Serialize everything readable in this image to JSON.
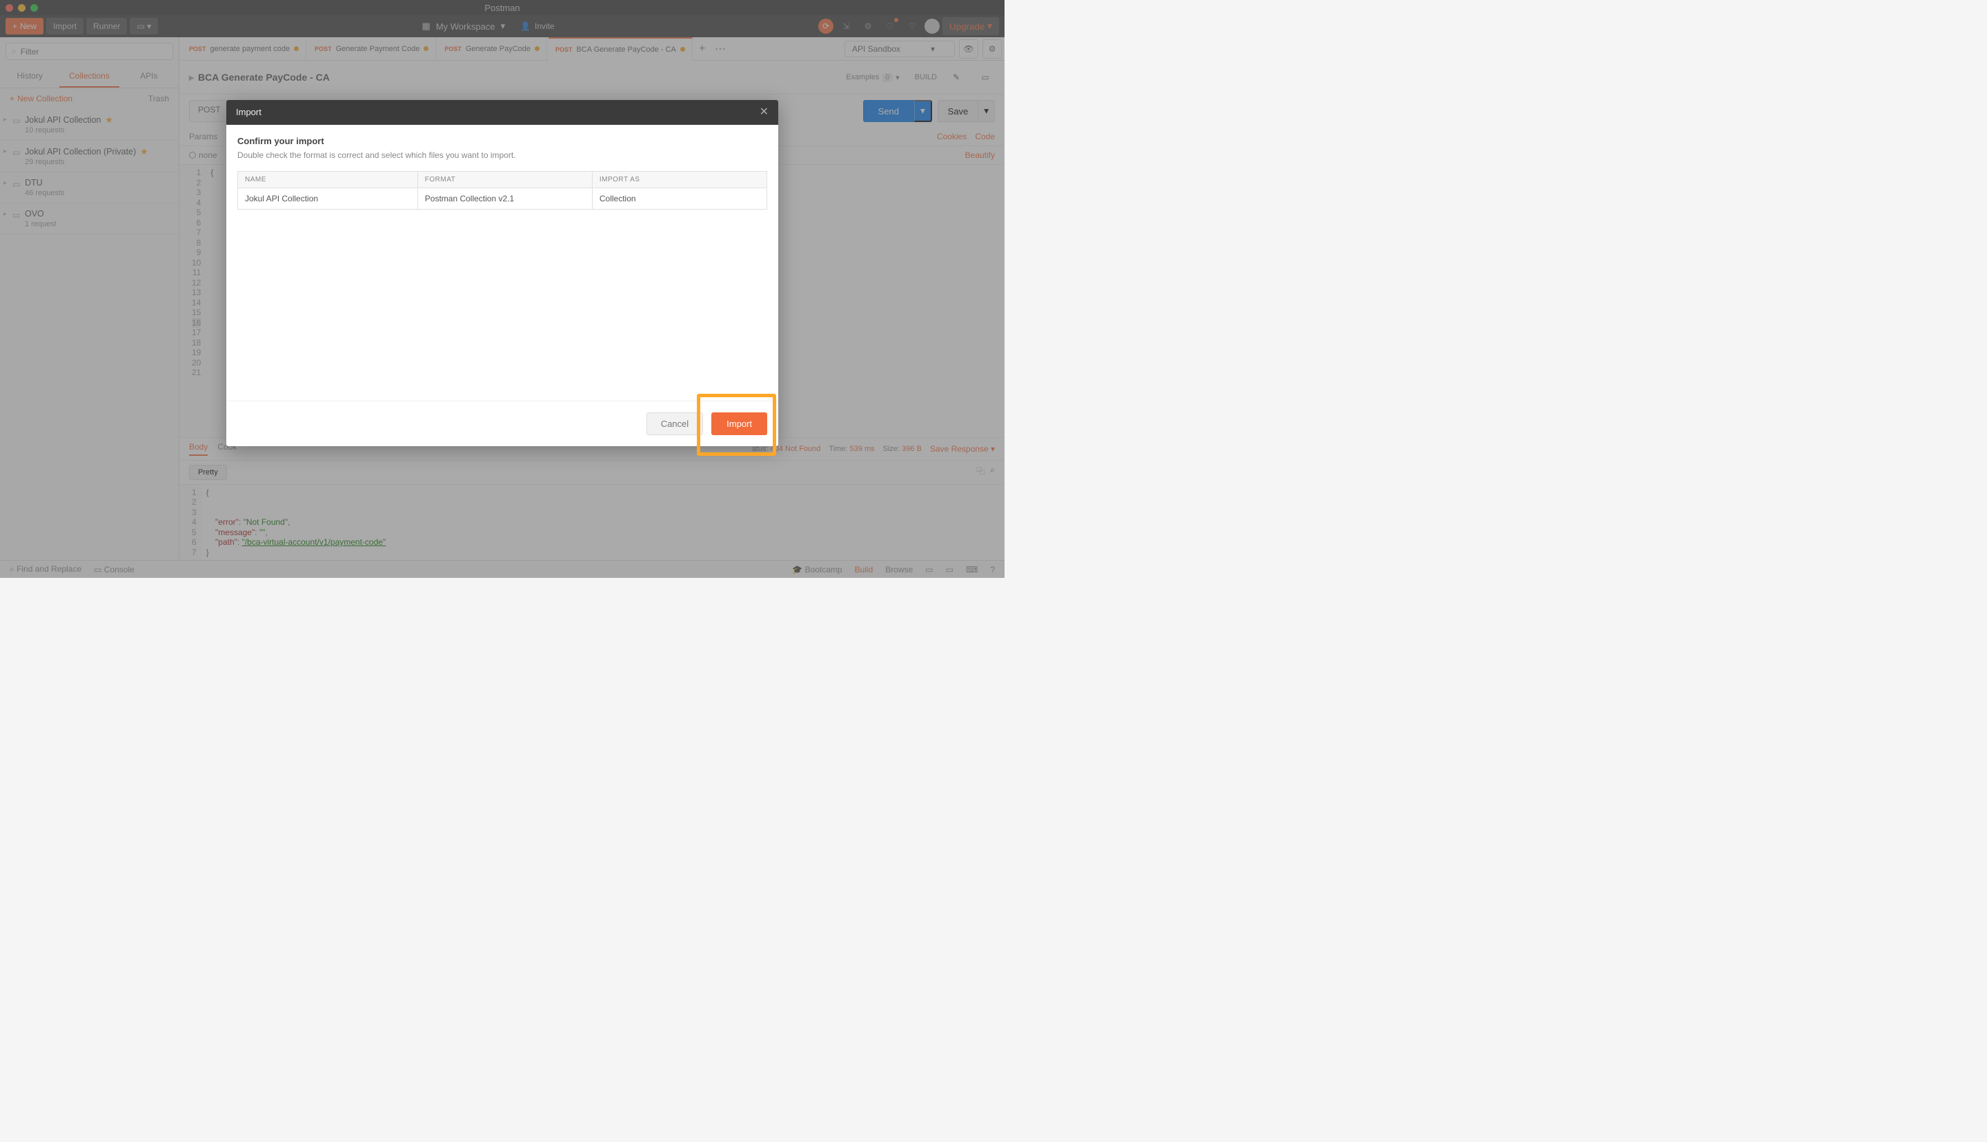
{
  "titlebar": {
    "title": "Postman"
  },
  "toolbar": {
    "new": "New",
    "import": "Import",
    "runner": "Runner",
    "workspace": "My Workspace",
    "invite": "Invite",
    "upgrade": "Upgrade"
  },
  "sidebar": {
    "filter_placeholder": "Filter",
    "tabs": {
      "history": "History",
      "collections": "Collections",
      "apis": "APIs"
    },
    "new_collection": "New Collection",
    "trash": "Trash",
    "items": [
      {
        "title": "Jokul API Collection",
        "sub": "10 requests",
        "starred": true
      },
      {
        "title": "Jokul API Collection (Private)",
        "sub": "29 requests",
        "starred": true
      },
      {
        "title": "DTU",
        "sub": "46 requests",
        "starred": false
      },
      {
        "title": "OVO",
        "sub": "1 request",
        "starred": false
      }
    ]
  },
  "tabs": [
    {
      "method": "POST",
      "name": "generate payment code"
    },
    {
      "method": "POST",
      "name": "Generate Payment Code"
    },
    {
      "method": "POST",
      "name": "Generate PayCode"
    },
    {
      "method": "POST",
      "name": "BCA Generate PayCode - CA"
    }
  ],
  "env": {
    "name": "API Sandbox"
  },
  "breadcrumb": {
    "path": "BCA Generate PayCode - CA",
    "examples": "Examples",
    "examples_count": "0",
    "build": "BUILD"
  },
  "url_row": {
    "method": "POST",
    "send": "Send",
    "save": "Save"
  },
  "params": {
    "params": "Params",
    "none": "none",
    "cookies": "Cookies",
    "code": "Code",
    "beautify": "Beautify"
  },
  "editor": {
    "first_line": "{",
    "line_numbers": [
      "1",
      "2",
      "3",
      "4",
      "5",
      "6",
      "7",
      "8",
      "9",
      "10",
      "11",
      "12",
      "13",
      "14",
      "15",
      "16",
      "17",
      "18",
      "19",
      "20",
      "21"
    ]
  },
  "response_meta": {
    "body": "Body",
    "cookies": "Cook",
    "status_label": "atus:",
    "status_val": "404 Not Found",
    "time_label": "Time:",
    "time_val": "539 ms",
    "size_label": "Size:",
    "size_val": "396 B",
    "save_response": "Save Response"
  },
  "pretty": "Pretty",
  "response_body": {
    "lines": [
      "1",
      "2",
      "3",
      "4",
      "5",
      "6",
      "7"
    ],
    "line1": "{",
    "error_key": "\"error\"",
    "error_val": "\"Not Found\"",
    "message_key": "\"message\"",
    "message_val": "\"\"",
    "path_key": "\"path\"",
    "path_val": "\"/bca-virtual-account/v1/payment-code\"",
    "line7": "}"
  },
  "statusbar": {
    "find": "Find and Replace",
    "console": "Console",
    "bootcamp": "Bootcamp",
    "build": "Build",
    "browse": "Browse"
  },
  "modal": {
    "title": "Import",
    "confirm_title": "Confirm your import",
    "confirm_sub": "Double check the format is correct and select which files you want to import.",
    "headers": {
      "name": "NAME",
      "format": "FORMAT",
      "import_as": "IMPORT AS"
    },
    "row": {
      "name": "Jokul API Collection",
      "format": "Postman Collection v2.1",
      "import_as": "Collection"
    },
    "cancel": "Cancel",
    "import": "Import"
  }
}
